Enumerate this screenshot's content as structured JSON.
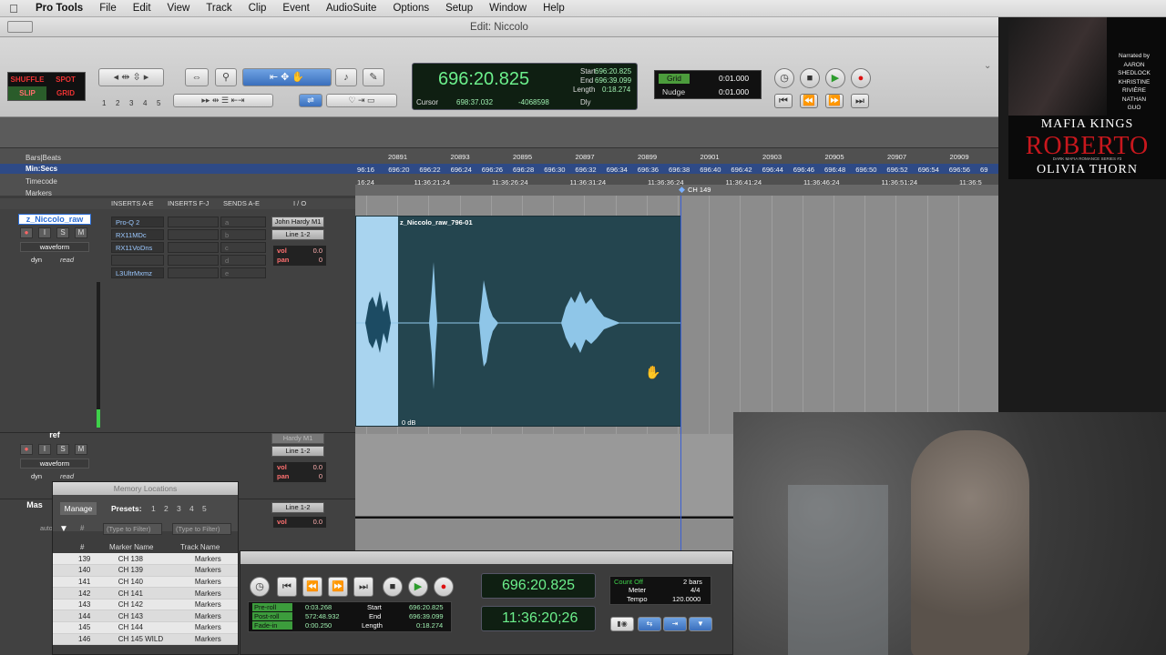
{
  "menubar": {
    "app_name": "Pro Tools",
    "items": [
      "File",
      "Edit",
      "View",
      "Track",
      "Clip",
      "Event",
      "AudioSuite",
      "Options",
      "Setup",
      "Window",
      "Help"
    ]
  },
  "window": {
    "title": "Edit: Niccolo"
  },
  "toolbar": {
    "modes": [
      "SHUFFLE",
      "SPOT",
      "SLIP",
      "GRID"
    ],
    "zoom_presets": [
      "1",
      "2",
      "3",
      "4",
      "5"
    ],
    "main_counter": "696:20.825",
    "cursor_label": "Cursor",
    "cursor_value": "698:37.032",
    "cursor_value2": "-4068598",
    "start_label": "Start",
    "end_label": "End",
    "length_label": "Length",
    "start_value": "696:20.825",
    "end_value": "696:39.099",
    "length_value": "0:18.274",
    "dly_label": "Dly",
    "grid_label": "Grid",
    "grid_value": "0:01.000",
    "nudge_label": "Nudge",
    "nudge_value": "0:01.000"
  },
  "rulers": {
    "bars_label": "Bars|Beats",
    "minsecs_label": "Min:Secs",
    "timecode_label": "Timecode",
    "markers_label": "Markers",
    "bars": [
      "20891",
      "20893",
      "20895",
      "20897",
      "20899",
      "20901",
      "20903",
      "20905",
      "20907",
      "20909"
    ],
    "minsecs": [
      "96:16",
      "696:20",
      "696:22",
      "696:24",
      "696:26",
      "696:28",
      "696:30",
      "696:32",
      "696:34",
      "696:36",
      "696:38",
      "696:40",
      "696:42",
      "696:44",
      "696:46",
      "696:48",
      "696:50",
      "696:52",
      "696:54",
      "696:56",
      "69"
    ],
    "timecode": [
      "16;24",
      "11:36:21;24",
      "11:36:26;24",
      "11:36:31;24",
      "11:36:36;24",
      "11:36:41;24",
      "11:36:46;24",
      "11:36:51;24",
      "11:36:5"
    ],
    "marker": "CH 149"
  },
  "columns": {
    "inserts_ae": "INSERTS A-E",
    "inserts_fj": "INSERTS F-J",
    "sends_ae": "SENDS A-E",
    "io": "I / O"
  },
  "tracks": [
    {
      "name": "z_Niccolo_raw",
      "view": "waveform",
      "dyn": "dyn",
      "automation": "read",
      "inserts": [
        "Pro-Q 2",
        "RX11MDc",
        "RX11VoDns",
        "",
        "L3UltrMxmz"
      ],
      "input": "John Hardy M1",
      "output": "Line 1-2",
      "vol": "0.0",
      "pan": "0",
      "vol_label": "vol",
      "pan_label": "pan"
    },
    {
      "name": "ref",
      "view": "waveform",
      "dyn": "dyn",
      "automation": "read",
      "input": "Hardy M1",
      "output": "Line 1-2",
      "vol": "0.0",
      "pan": "0",
      "vol_label": "vol",
      "pan_label": "pan"
    },
    {
      "name": "Mas",
      "output": "Line 1-2",
      "vol": "0.0",
      "vol_label": "vol",
      "auto": "auto"
    }
  ],
  "send_letters": [
    "a",
    "b",
    "c",
    "d",
    "e"
  ],
  "clip": {
    "name": "z_Niccolo_raw_796-01",
    "gain": "0 dB"
  },
  "memory_locations": {
    "title": "Memory Locations",
    "manage": "Manage",
    "presets_label": "Presets:",
    "presets": [
      "1",
      "2",
      "3",
      "4",
      "5"
    ],
    "filter_placeholder": "(Type to Filter)",
    "col_num": "#",
    "col_marker": "Marker Name",
    "col_track": "Track Name",
    "rows": [
      {
        "num": "139",
        "name": "CH 138",
        "track": "Markers"
      },
      {
        "num": "140",
        "name": "CH 139",
        "track": "Markers"
      },
      {
        "num": "141",
        "name": "CH 140",
        "track": "Markers"
      },
      {
        "num": "142",
        "name": "CH 141",
        "track": "Markers"
      },
      {
        "num": "143",
        "name": "CH 142",
        "track": "Markers"
      },
      {
        "num": "144",
        "name": "CH 143",
        "track": "Markers"
      },
      {
        "num": "145",
        "name": "CH 144",
        "track": "Markers"
      },
      {
        "num": "146",
        "name": "CH 145 WILD",
        "track": "Markers"
      }
    ]
  },
  "transport_window": {
    "main_counter": "696:20.825",
    "sub_counter": "11:36:20;26",
    "preroll_label": "Pre-roll",
    "postroll_label": "Post-roll",
    "fadein_label": "Fade-in",
    "preroll": "0:03.268",
    "postroll": "572:48.932",
    "fadein": "0:00.250",
    "start_label": "Start",
    "end_label": "End",
    "length_label": "Length",
    "start": "696:20.825",
    "end": "696:39.099",
    "length": "0:18.274",
    "countoff": "Count Off",
    "bars": "2 bars",
    "meter_label": "Meter",
    "meter": "4/4",
    "tempo_label": "Tempo",
    "tempo": "120.0000"
  },
  "promo": {
    "narrated": "Narrated by",
    "narrators": [
      "AARON",
      "SHEDLOCK",
      "KHRISTINE",
      "RIVIÈRE",
      "NATHAN",
      "GUO"
    ],
    "series": "MAFIA KINGS",
    "title": "ROBERTO",
    "subtitle": "DARK MAFIA ROMANCE SERIES #3",
    "author": "OLIVIA THORN"
  },
  "colors": {
    "accent_blue": "#2b6dd6",
    "counter_green": "#6cf08c",
    "clip_teal": "#24454f",
    "waveform": "#8fc6e8",
    "record_red": "#e02020"
  }
}
